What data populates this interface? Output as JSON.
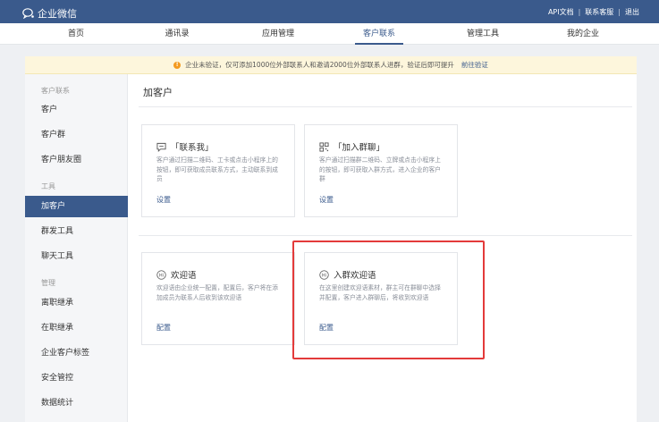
{
  "topbar": {
    "app_name": "企业微信",
    "links": [
      "API文档",
      "联系客服",
      "退出"
    ],
    "separator": "|"
  },
  "nav": {
    "items": [
      "首页",
      "通讯录",
      "应用管理",
      "客户联系",
      "管理工具",
      "我的企业"
    ],
    "active": "客户联系"
  },
  "notice": {
    "text": "企业未验证，仅可添加1000位外部联系人和邀请2000位外部联系人进群，验证后即可提升",
    "link": "前往验证",
    "icon": "warning-icon"
  },
  "sidebar": {
    "group_customer": "客户联系",
    "customer_items": [
      "客户",
      "客户群",
      "客户朋友圈"
    ],
    "group_tools": "工具",
    "tool_items": [
      "加客户",
      "群发工具",
      "聊天工具"
    ],
    "group_manage": "管理",
    "manage_items": [
      "离职继承",
      "在职继承",
      "企业客户标签",
      "安全管控",
      "数据统计"
    ],
    "active": "加客户"
  },
  "main": {
    "title": "加客户",
    "cards": [
      {
        "icon": "chat-bubble-icon",
        "title": "「联系我」",
        "desc": "客户通过扫描二维码、工卡或点击小程序上的按钮，即可获取成员联系方式，主动联系到成员",
        "link": "设置"
      },
      {
        "icon": "qr-code-icon",
        "title": "「加入群聊」",
        "desc": "客户通过扫描群二维码、立牌或点击小程序上的按钮，即可获取入群方式，进入企业的客户群",
        "link": "设置"
      },
      {
        "icon": "hi-icon",
        "title": "欢迎语",
        "desc": "欢迎语由企业统一配置，配置后，客户将在添加成员为联系人后收到该欢迎语",
        "link": "配置"
      },
      {
        "icon": "hi-icon",
        "title": "入群欢迎语",
        "desc": "在这里创建欢迎语素材，群主可在群聊中选择并配置，客户进入群聊后，将收到欢迎语",
        "link": "配置"
      }
    ]
  },
  "colors": {
    "brand": "#3a5a8c",
    "highlight": "#e33a3a",
    "notice_bg": "#fdf6dc",
    "warning": "#f39a1f"
  }
}
